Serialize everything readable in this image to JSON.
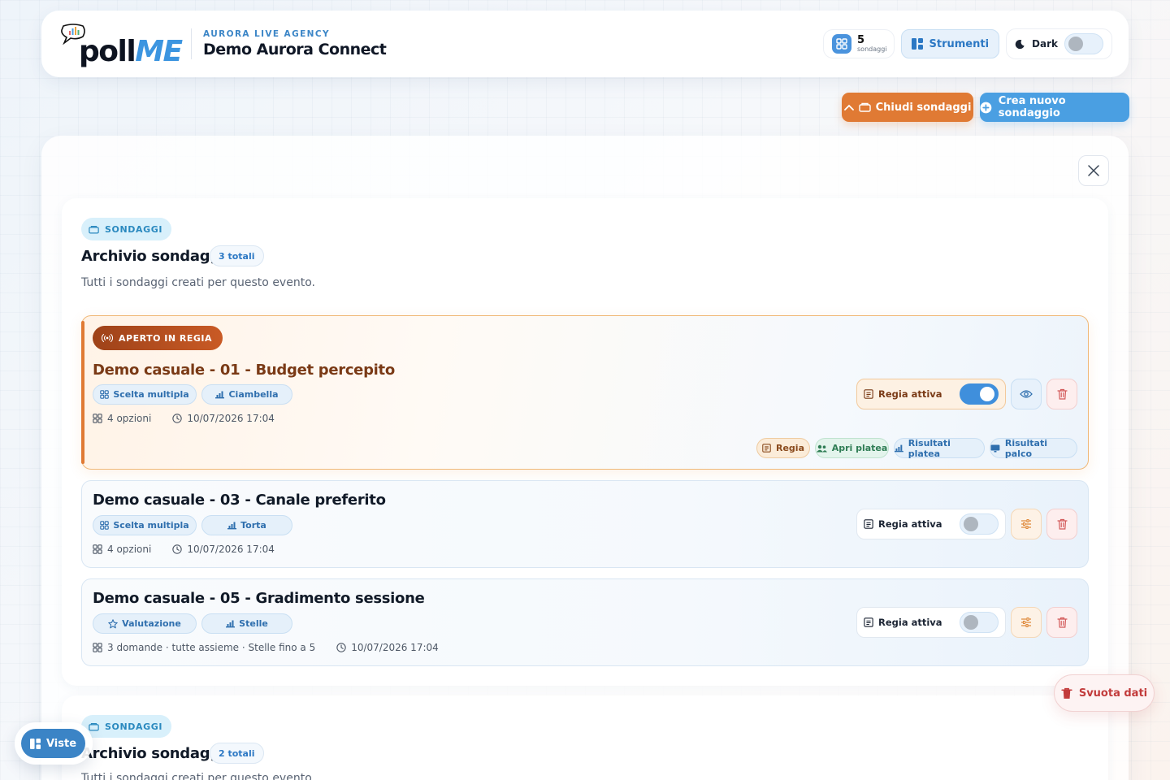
{
  "header": {
    "logo": {
      "poll": "poll",
      "me": "ME"
    },
    "agency_kicker": "AURORA LIVE AGENCY",
    "event_name": "Demo Aurora Connect",
    "poll_count": "5",
    "poll_count_label": "sondaggi",
    "tools_label": "Strumenti",
    "dark_label": "Dark",
    "dark_mode_on": false
  },
  "actions": {
    "close_polls": "Chiudi sondaggi",
    "new_poll": "Crea nuovo sondaggio"
  },
  "sections": [
    {
      "kicker": "SONDAGGI",
      "title": "Archivio sondaggi",
      "total": "3 totali",
      "subtitle": "Tutti i sondaggi creati per questo evento.",
      "polls": [
        {
          "live_badge": "APERTO IN REGIA",
          "title": "Demo casuale - 01 - Budget percepito",
          "type_tag": "Scelta multipla",
          "chart_tag": "Ciambella",
          "options": "4 opzioni",
          "date": "10/07/2026 17:04",
          "regia_label": "Regia attiva",
          "regia_on": true,
          "links": [
            "Regia",
            "Apri platea",
            "Risultati platea",
            "Risultati palco"
          ]
        },
        {
          "title": "Demo casuale - 03 - Canale preferito",
          "type_tag": "Scelta multipla",
          "chart_tag": "Torta",
          "options": "4 opzioni",
          "date": "10/07/2026 17:04",
          "regia_label": "Regia attiva",
          "regia_on": false
        },
        {
          "title": "Demo casuale - 05 - Gradimento sessione",
          "type_tag": "Valutazione",
          "chart_tag": "Stelle",
          "options": "3 domande · tutte assieme · Stelle fino a 5",
          "date": "10/07/2026 17:04",
          "regia_label": "Regia attiva",
          "regia_on": false
        }
      ]
    },
    {
      "kicker": "SONDAGGI",
      "title": "Archivio sondaggi",
      "total": "2 totali",
      "subtitle": "Tutti i sondaggi creati per questo evento."
    }
  ],
  "floating": {
    "clear_data": "Svuota dati",
    "views": "Viste"
  },
  "colors": {
    "accent_blue": "#4a9fe2",
    "accent_orange": "#e07a34",
    "danger": "#c23b3b"
  }
}
